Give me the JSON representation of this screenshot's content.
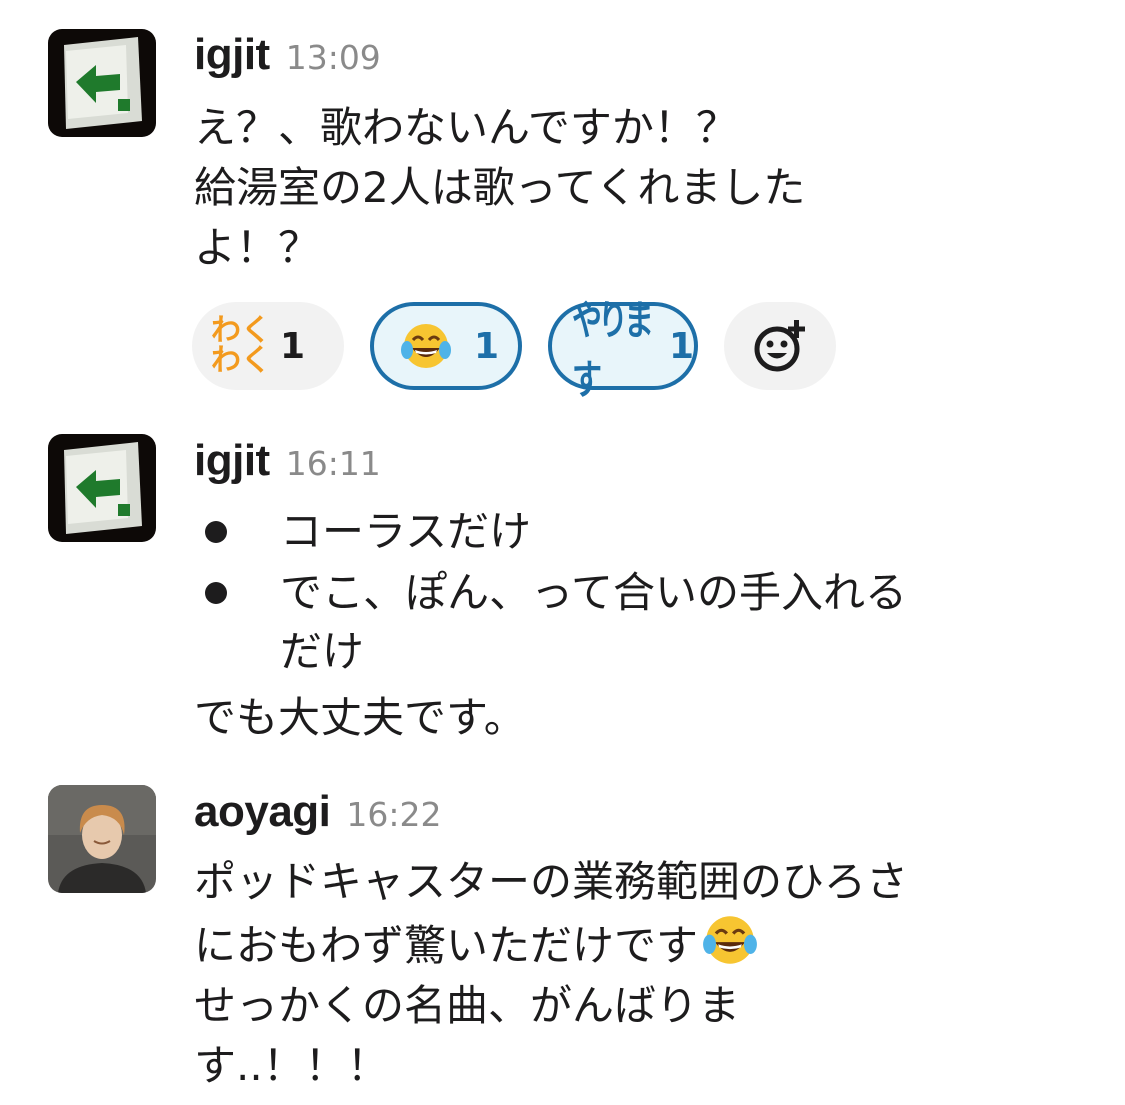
{
  "messages": [
    {
      "user": "igjit",
      "time": "13:09",
      "lines": [
        "え？、歌わないんですか！？",
        "給湯室の2人は歌ってくれました",
        "よ！？"
      ],
      "reactions": [
        {
          "emoji": "waku-waku",
          "text": [
            "わく",
            "わく"
          ],
          "count": "1",
          "active": false
        },
        {
          "emoji": "joy",
          "count": "1",
          "active": true
        },
        {
          "emoji": "yarimasu",
          "text": "やります",
          "count": "1",
          "active": true
        }
      ]
    },
    {
      "user": "igjit",
      "time": "16:11",
      "bullets": [
        "コーラスだけ",
        "でこ、ぽん、って合いの手入れる",
        "だけ"
      ],
      "after": "でも大丈夫です。"
    },
    {
      "user": "aoyagi",
      "time": "16:22",
      "lines": [
        "ポッドキャスターの業務範囲のひろさ",
        "におもわず驚いただけです",
        "せっかくの名曲、がんばりま",
        "す..！！！"
      ],
      "inline_emoji": "joy"
    }
  ],
  "icons": {
    "igjit_avatar": "emergency-exit-sign",
    "aoyagi_avatar": "person-portrait",
    "add_reaction": "add-reaction-smiley-icon"
  },
  "colors": {
    "active_reaction_border": "#1d6fa8",
    "active_reaction_bg": "#e8f5fa",
    "timestamp": "#8a8a8a",
    "waku_orange": "#f39a1e"
  }
}
